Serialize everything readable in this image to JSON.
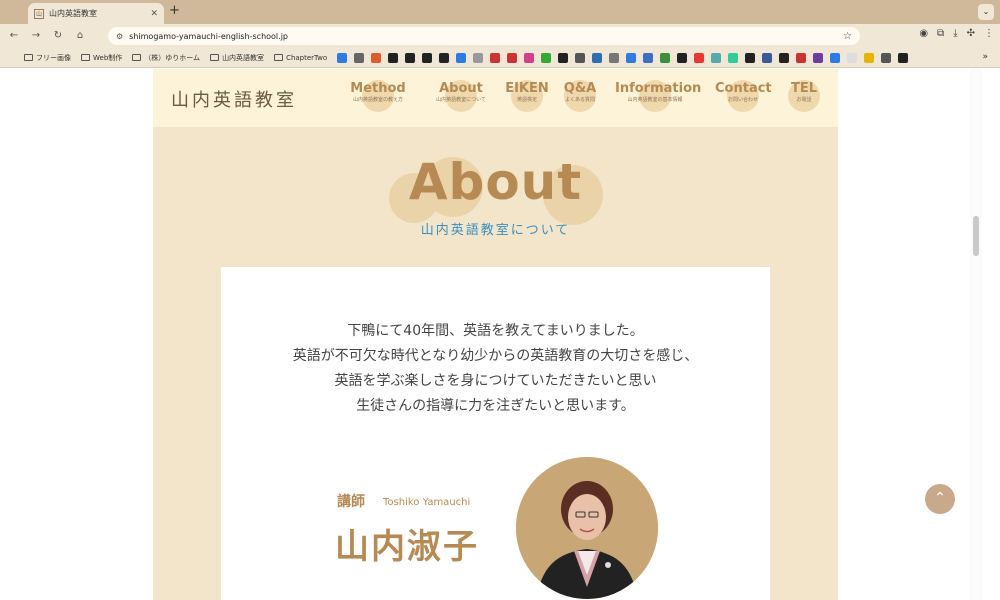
{
  "browser": {
    "tab_title": "山内英語教室",
    "tab_favicon": "山",
    "url": "shimogamo-yamauchi-english-school.jp",
    "bookmarks": [
      "フリー画像",
      "Web制作",
      "（株）ゆりホーム",
      "山内英語教室",
      "ChapterTwo"
    ],
    "bookmark_icon_colors": [
      "#2d7be5",
      "#666",
      "#e25b2b",
      "#222",
      "#222",
      "#222",
      "#222",
      "#2d7be5",
      "#999",
      "#c33",
      "#c33",
      "#d43f8d",
      "#3a3",
      "#222",
      "#555",
      "#2d6fb5",
      "#777",
      "#2d7be5",
      "#3a6fc4",
      "#3a8f3a",
      "#222",
      "#e33",
      "#5aa",
      "#3c9",
      "#222",
      "#3b5998",
      "#222",
      "#c33",
      "#6a3ea1",
      "#2d7be5",
      "#ddd",
      "#e8b400",
      "#555",
      "#222"
    ]
  },
  "site": {
    "logo": "山内英語教室",
    "nav": [
      {
        "en": "Method",
        "ja": "山内英語教室の教え方"
      },
      {
        "en": "About",
        "ja": "山内英語教室について"
      },
      {
        "en": "EIKEN",
        "ja": "英語検定"
      },
      {
        "en": "Q&A",
        "ja": "よくある質問"
      },
      {
        "en": "Information",
        "ja": "山内英語教室の基本情報"
      },
      {
        "en": "Contact",
        "ja": "お問い合わせ"
      },
      {
        "en": "TEL",
        "ja": "お電話"
      }
    ],
    "section_title": "About",
    "section_subtitle": "山内英語教室について",
    "intro_lines": [
      "下鴨にて40年間、英語を教えてまいりました。",
      "英語が不可欠な時代となり幼少からの英語教育の大切さを感じ、",
      "英語を学ぶ楽しさを身につけていただきたいと思い",
      "生徒さんの指導に力を注ぎたいと思います。"
    ],
    "teacher_label": "講師",
    "teacher_roman": "Toshiko Yamauchi",
    "teacher_name": "山内淑子"
  },
  "colors": {
    "accent": "#b68a52",
    "subtitle": "#3a8fc4",
    "page_bg": "#f3e5c9",
    "header_bg": "#fdf3d8"
  }
}
